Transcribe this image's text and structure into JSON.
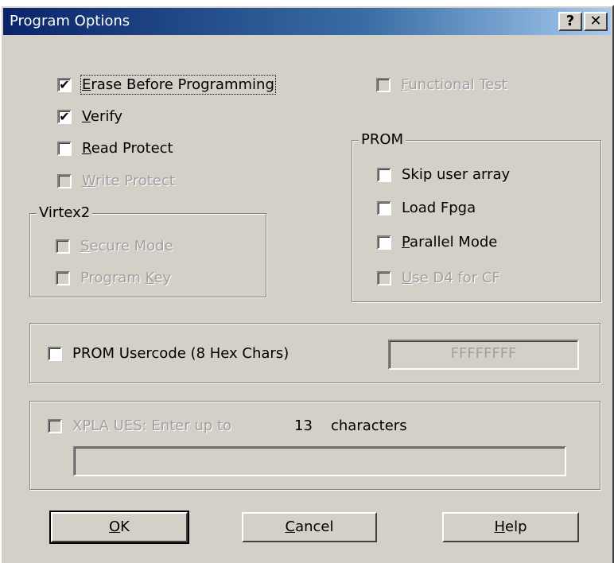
{
  "window": {
    "title": "Program Options",
    "help_glyph": "?",
    "close_glyph": "✕"
  },
  "options": {
    "erase": {
      "prefix": "",
      "u": "E",
      "rest": "rase Before Programming",
      "checked": true
    },
    "verify": {
      "prefix": "",
      "u": "V",
      "rest": "erify",
      "checked": true
    },
    "read_protect": {
      "prefix": "",
      "u": "R",
      "rest": "ead Protect",
      "checked": false
    },
    "write_protect": {
      "prefix": "",
      "u": "W",
      "rest": "rite Protect",
      "checked": false
    },
    "functional_test": {
      "prefix": "",
      "u": "F",
      "rest": "unctional Test",
      "checked": false
    }
  },
  "virtex2": {
    "title": "Virtex2",
    "secure_mode": {
      "prefix": "",
      "u": "S",
      "rest": "ecure Mode"
    },
    "program_key": {
      "prefix": "Program ",
      "u": "K",
      "rest": "ey"
    }
  },
  "prom": {
    "title": "PROM",
    "skip_user_array": "Skip user array",
    "load_fpga": "Load Fpga",
    "parallel_mode": {
      "prefix": "",
      "u": "P",
      "rest": "arallel Mode"
    },
    "use_d4": {
      "prefix": "",
      "u": "U",
      "rest": "se D4 for CF"
    }
  },
  "usercode": {
    "label": "PROM Usercode (8 Hex Chars)",
    "value": "FFFFFFFF"
  },
  "xpla": {
    "label": "XPLA UES: Enter up to",
    "count": "13",
    "suffix": "characters",
    "value": ""
  },
  "buttons": {
    "ok": {
      "u": "O",
      "rest": "K"
    },
    "cancel": {
      "u": "C",
      "rest": "ancel"
    },
    "help": {
      "u": "H",
      "rest": "elp"
    }
  },
  "colors": {
    "face": "#d4d0c8",
    "title_start": "#0a246a",
    "title_end": "#a6caf0",
    "disabled_text": "#a0a0a0"
  }
}
